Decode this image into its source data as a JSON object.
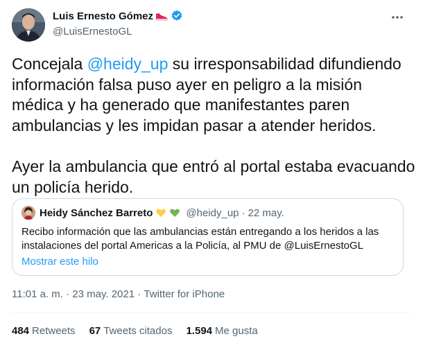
{
  "author": {
    "display_name": "Luis Ernesto Gómez",
    "handle": "@LuisErnestoGL"
  },
  "tweet": {
    "text_before_mention": "Concejala ",
    "mention": "@heidy_up",
    "text_after_mention": " su irresponsabilidad difundiendo información falsa puso ayer en peligro a la misión médica y ha generado que manifestantes paren ambulancias y les impidan pasar a atender heridos.",
    "paragraph_2": "Ayer la ambulancia que entró al portal estaba evacuando un policía herido."
  },
  "quote": {
    "display_name": "Heidy Sánchez Barreto",
    "handle": "@heidy_up",
    "separator": "·",
    "date": "22 may.",
    "text": "Recibo información que las ambulancias están entregando a los heridos a las instalaciones del portal Americas a la Policía, al PMU de @LuisErnestoGL",
    "show_thread": "Mostrar este hilo"
  },
  "meta": {
    "time": "11:01 a. m.",
    "sep": " · ",
    "date": "23 may. 2021",
    "source": "Twitter for iPhone"
  },
  "stats": {
    "retweets_count": "484",
    "retweets_label": "Retweets",
    "quotes_count": "67",
    "quotes_label": "Tweets citados",
    "likes_count": "1.594",
    "likes_label": "Me gusta"
  },
  "colors": {
    "accent": "#1d9bf0",
    "text": "#0f1419",
    "secondary": "#536471",
    "border": "#cfd9de"
  }
}
